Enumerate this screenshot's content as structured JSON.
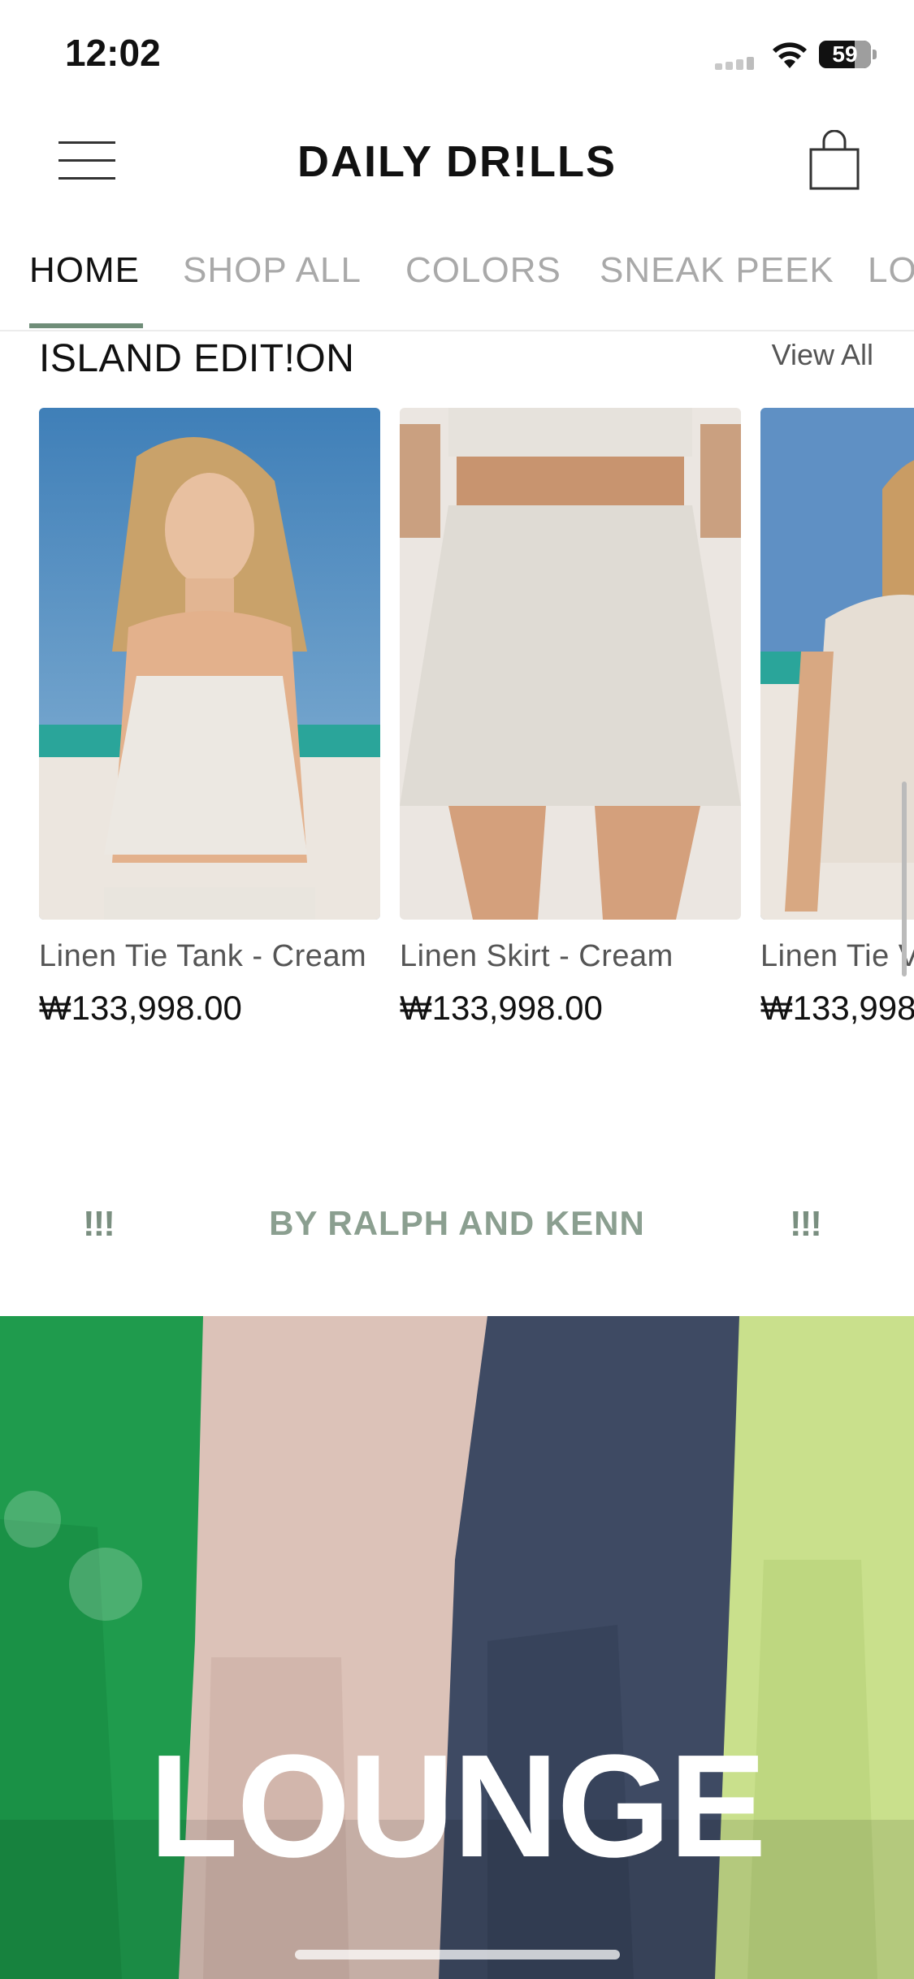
{
  "status": {
    "time": "12:02",
    "battery": "59"
  },
  "header": {
    "brand": "DAILY DR!LLS"
  },
  "tabs": [
    "HOME",
    "SHOP ALL",
    "COLORS",
    "SNEAK PEEK",
    "LO"
  ],
  "section": {
    "title": "ISLAND EDIT!ON",
    "view_all": "View All"
  },
  "products": [
    {
      "name": "Linen Tie Tank - Cream",
      "price": "₩133,998.00"
    },
    {
      "name": "Linen Skirt - Cream",
      "price": "₩133,998.00"
    },
    {
      "name": "Linen Tie V",
      "price": "₩133,998"
    }
  ],
  "marquee": {
    "left_mark": "!!!",
    "text": "BY RALPH AND KENN",
    "right_mark": "!!!"
  },
  "banner": {
    "title": "LOUNGE"
  },
  "colors": {
    "accent": "#6f8d78",
    "marquee_text": "#8b9f90"
  }
}
